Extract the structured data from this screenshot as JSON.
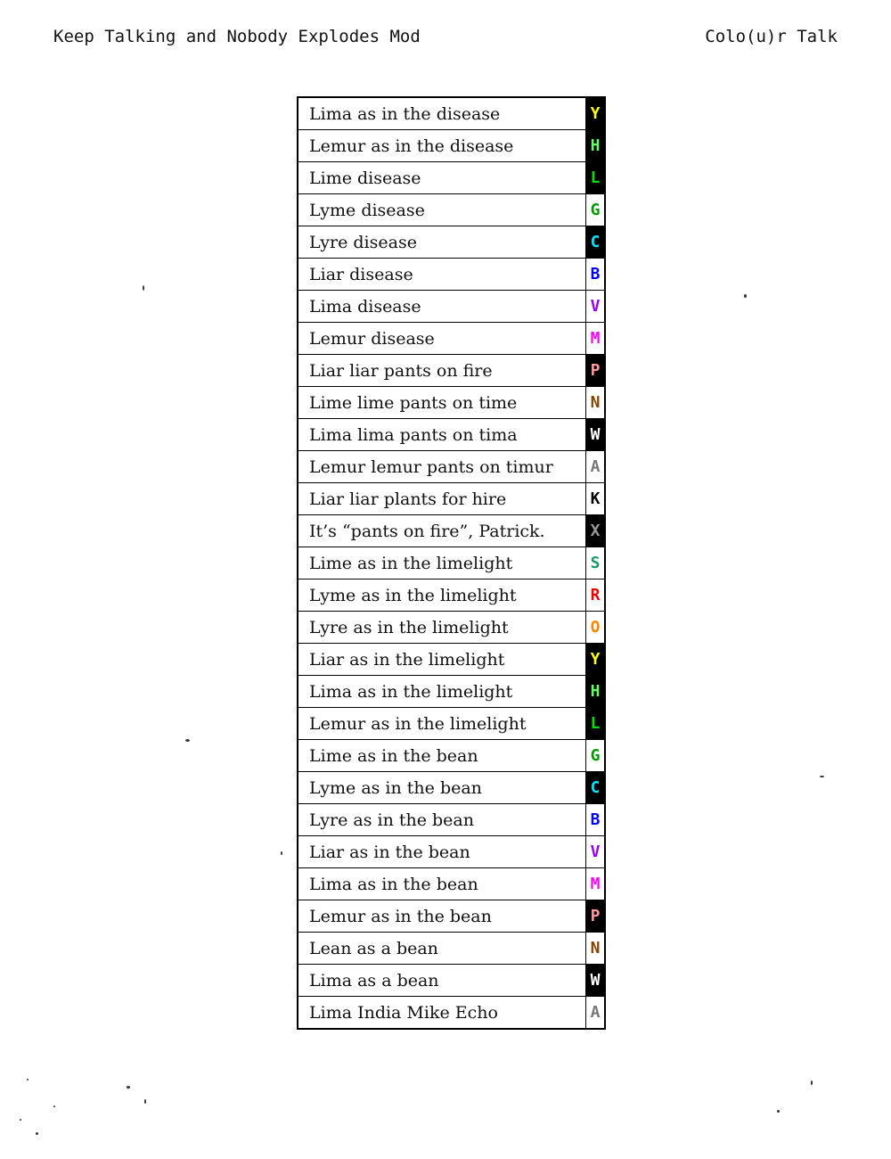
{
  "header": {
    "left_title": "Keep Talking and Nobody Explodes Mod",
    "right_title": "Colo(u)r Talk"
  },
  "rows": [
    {
      "phrase": "Lima as in the disease",
      "letter": "Y",
      "color": "#ffff00",
      "bg": "#000000"
    },
    {
      "phrase": "Lemur as in the disease",
      "letter": "H",
      "color": "#66ff66",
      "bg": "#000000"
    },
    {
      "phrase": "Lime disease",
      "letter": "L",
      "color": "#00dd00",
      "bg": "#000000"
    },
    {
      "phrase": "Lyme disease",
      "letter": "G",
      "color": "#009900",
      "bg": "#ffffff"
    },
    {
      "phrase": "Lyre disease",
      "letter": "C",
      "color": "#00e5ff",
      "bg": "#000000"
    },
    {
      "phrase": "Liar disease",
      "letter": "B",
      "color": "#0000ff",
      "bg": "#ffffff"
    },
    {
      "phrase": "Lima disease",
      "letter": "V",
      "color": "#9900ff",
      "bg": "#ffffff"
    },
    {
      "phrase": "Lemur disease",
      "letter": "M",
      "color": "#ff00ff",
      "bg": "#ffffff"
    },
    {
      "phrase": "Liar liar pants on fire",
      "letter": "P",
      "color": "#ff9999",
      "bg": "#000000"
    },
    {
      "phrase": "Lime lime pants on time",
      "letter": "N",
      "color": "#8b4500",
      "bg": "#ffffff"
    },
    {
      "phrase": "Lima lima pants on tima",
      "letter": "W",
      "color": "#ffffff",
      "bg": "#000000"
    },
    {
      "phrase": "Lemur lemur pants on timur",
      "letter": "A",
      "color": "#777777",
      "bg": "#ffffff"
    },
    {
      "phrase": "Liar liar plants for hire",
      "letter": "K",
      "color": "#000000",
      "bg": "#ffffff"
    },
    {
      "phrase": "It’s “pants on fire”, Patrick.",
      "letter": "X",
      "color": "#999999",
      "bg": "#000000"
    },
    {
      "phrase": "Lime as in the limelight",
      "letter": "S",
      "color": "#1a9966",
      "bg": "#ffffff"
    },
    {
      "phrase": "Lyme as in the limelight",
      "letter": "R",
      "color": "#ee0000",
      "bg": "#ffffff"
    },
    {
      "phrase": "Lyre as in the limelight",
      "letter": "O",
      "color": "#ff8800",
      "bg": "#ffffff"
    },
    {
      "phrase": "Liar as in the limelight",
      "letter": "Y",
      "color": "#ffff00",
      "bg": "#000000"
    },
    {
      "phrase": "Lima as in the limelight",
      "letter": "H",
      "color": "#66ff66",
      "bg": "#000000"
    },
    {
      "phrase": "Lemur as in the limelight",
      "letter": "L",
      "color": "#00dd00",
      "bg": "#000000"
    },
    {
      "phrase": "Lime as in the bean",
      "letter": "G",
      "color": "#009900",
      "bg": "#ffffff"
    },
    {
      "phrase": "Lyme as in the bean",
      "letter": "C",
      "color": "#00e5ff",
      "bg": "#000000"
    },
    {
      "phrase": "Lyre as in the bean",
      "letter": "B",
      "color": "#0000ff",
      "bg": "#ffffff"
    },
    {
      "phrase": "Liar as in the bean",
      "letter": "V",
      "color": "#9900ff",
      "bg": "#ffffff"
    },
    {
      "phrase": "Lima as in the bean",
      "letter": "M",
      "color": "#ff00ff",
      "bg": "#ffffff"
    },
    {
      "phrase": "Lemur as in the bean",
      "letter": "P",
      "color": "#ff9999",
      "bg": "#000000"
    },
    {
      "phrase": "Lean as a bean",
      "letter": "N",
      "color": "#8b4500",
      "bg": "#ffffff"
    },
    {
      "phrase": "Lima as a bean",
      "letter": "W",
      "color": "#ffffff",
      "bg": "#000000"
    },
    {
      "phrase": "Lima India Mike Echo",
      "letter": "A",
      "color": "#777777",
      "bg": "#ffffff"
    }
  ]
}
